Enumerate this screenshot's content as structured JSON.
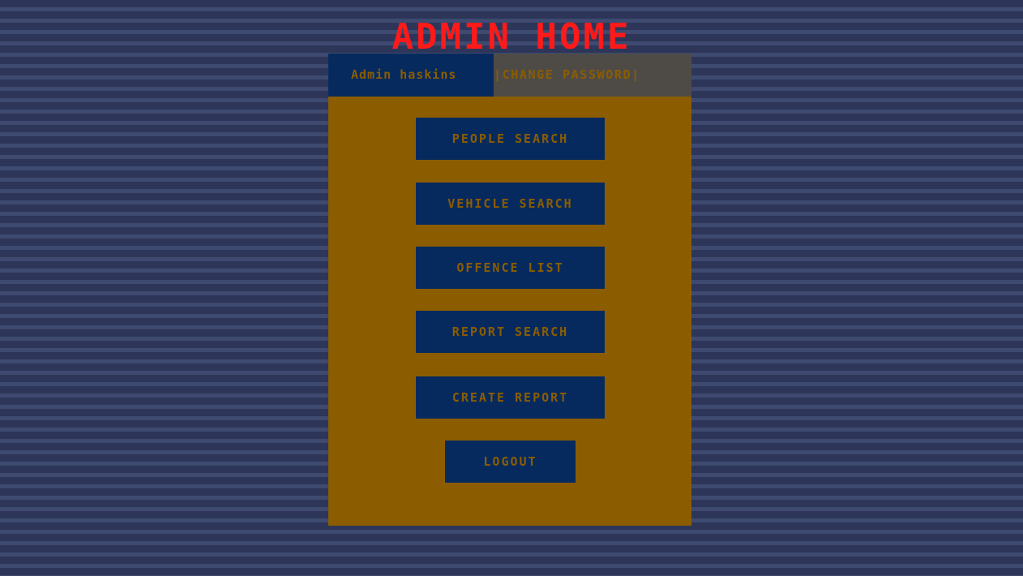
{
  "page": {
    "title": "ADMIN HOME"
  },
  "topbar": {
    "user_label": "Admin haskins",
    "change_password_label": "|CHANGE PASSWORD|"
  },
  "menu": {
    "people_search": "PEOPLE SEARCH",
    "vehicle_search": "VEHICLE SEARCH",
    "offence_list": "OFFENCE LIST",
    "report_search": "REPORT SEARCH",
    "create_report": "CREATE REPORT",
    "logout": "LOGOUT"
  },
  "colors": {
    "background": "#2d3659",
    "background_stripe": "#3e4a70",
    "title": "#ff1a1a",
    "panel": "#8b5d00",
    "button": "#072a5e",
    "change_password_bg": "#4e4b47"
  }
}
